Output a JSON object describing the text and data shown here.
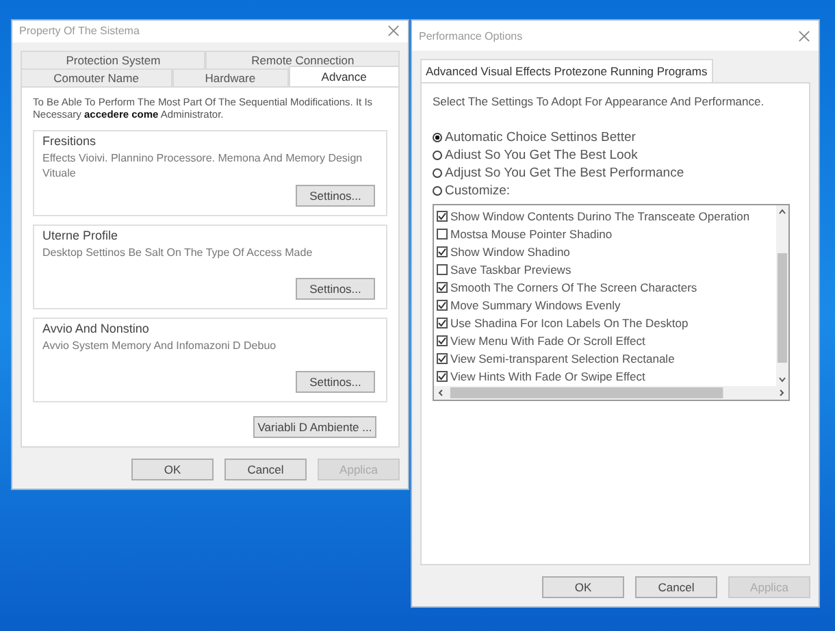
{
  "system_properties": {
    "title": "Property Of The Sistema",
    "tab_rows": [
      [
        {
          "label": "Protection System",
          "selected": false
        },
        {
          "label": "Remote Connection",
          "selected": false
        }
      ],
      [
        {
          "label": "Comouter Name",
          "selected": false
        },
        {
          "label": "Hardware",
          "selected": false
        },
        {
          "label": "Advance",
          "selected": true
        }
      ]
    ],
    "intro": "To Be Able To Perform The Most Part Of The Sequential Modifications. It Is Necessary **accedere come** Administrator.",
    "groups": [
      {
        "title": "Fresitions",
        "text": "Effects Vioivi. Plannino Processore. Memona And Memory Design Vituale",
        "button": "Settinos..."
      },
      {
        "title": "Uterne Profile",
        "text": "Desktop Settinos Be Salt On The Type Of Access Made",
        "button": "Settinos..."
      },
      {
        "title": "Avvio And Nonstino",
        "text": "Avvio System Memory And Infomazoni D Debuo",
        "button": "Settinos..."
      }
    ],
    "env_button": "Variabli D Ambiente ...",
    "buttons": [
      {
        "label": "OK",
        "disabled": false
      },
      {
        "label": "Cancel",
        "disabled": false
      },
      {
        "label": "Applica",
        "disabled": true
      }
    ]
  },
  "performance_options": {
    "title": "Performance Options",
    "tabs": [
      {
        "label": "Advanced Visual Effects Protezone Running Programs",
        "selected": true
      }
    ],
    "instruction": "Select The Settings To Adopt For Appearance And Performance.",
    "options": [
      {
        "label": "Automatic Choice Settinos Better",
        "selected": true
      },
      {
        "label": "Adiust So You Get The Best Look",
        "selected": false
      },
      {
        "label": "Adjust So You Get The Best Performance",
        "selected": false
      },
      {
        "label": "Customize:",
        "selected": false
      }
    ],
    "effects": [
      {
        "label": "Show Window Contents Durino The Transceate Operation",
        "checked": true
      },
      {
        "label": "Mostsa Mouse Pointer Shadino",
        "checked": false
      },
      {
        "label": "Show Window Shadino",
        "checked": true
      },
      {
        "label": "Save Taskbar Previews",
        "checked": false
      },
      {
        "label": "Smooth The Corners Of The Screen Characters",
        "checked": true
      },
      {
        "label": "Move Summary Windows Evenly",
        "checked": true
      },
      {
        "label": "Use Shadina For Icon Labels On The Desktop",
        "checked": true
      },
      {
        "label": "View Menu With Fade Or Scroll Effect",
        "checked": true
      },
      {
        "label": "View Semi-transparent Selection Rectanale",
        "checked": true
      },
      {
        "label": "View Hints With Fade Or Swipe Effect",
        "checked": true
      }
    ],
    "buttons": [
      {
        "label": "OK",
        "disabled": false
      },
      {
        "label": "Cancel",
        "disabled": false
      },
      {
        "label": "Applica",
        "disabled": true
      }
    ]
  }
}
